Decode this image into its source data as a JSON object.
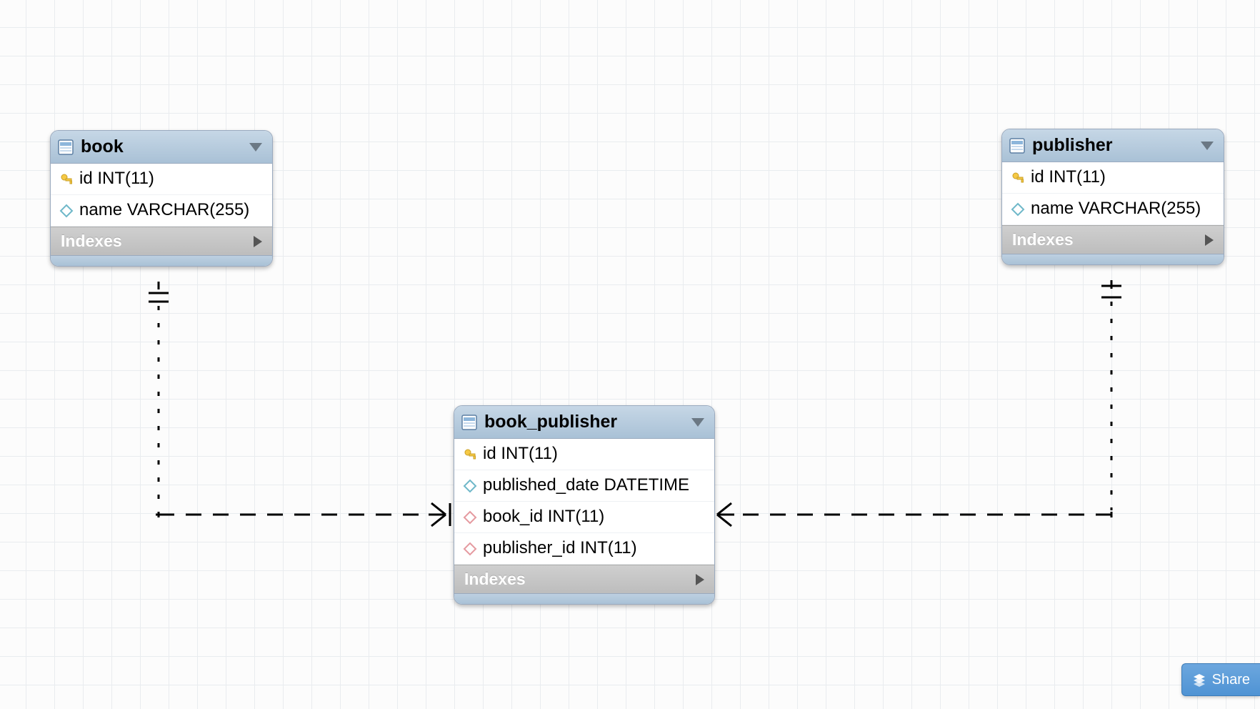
{
  "share_button": {
    "label": "Share"
  },
  "entities": {
    "book": {
      "title": "book",
      "indexes_label": "Indexes",
      "columns": [
        {
          "icon": "key",
          "text": "id INT(11)"
        },
        {
          "icon": "diamond",
          "text": "name VARCHAR(255)"
        }
      ]
    },
    "publisher": {
      "title": "publisher",
      "indexes_label": "Indexes",
      "columns": [
        {
          "icon": "key",
          "text": "id INT(11)"
        },
        {
          "icon": "diamond",
          "text": "name VARCHAR(255)"
        }
      ]
    },
    "book_publisher": {
      "title": "book_publisher",
      "indexes_label": "Indexes",
      "columns": [
        {
          "icon": "key",
          "text": "id INT(11)"
        },
        {
          "icon": "diamond",
          "text": "published_date DATETIME"
        },
        {
          "icon": "diamond-fk",
          "text": "book_id INT(11)"
        },
        {
          "icon": "diamond-fk",
          "text": "publisher_id INT(11)"
        }
      ]
    }
  },
  "relations": [
    {
      "from": "book",
      "to": "book_publisher",
      "cardinality": "one-to-many"
    },
    {
      "from": "publisher",
      "to": "book_publisher",
      "cardinality": "one-to-many"
    }
  ]
}
